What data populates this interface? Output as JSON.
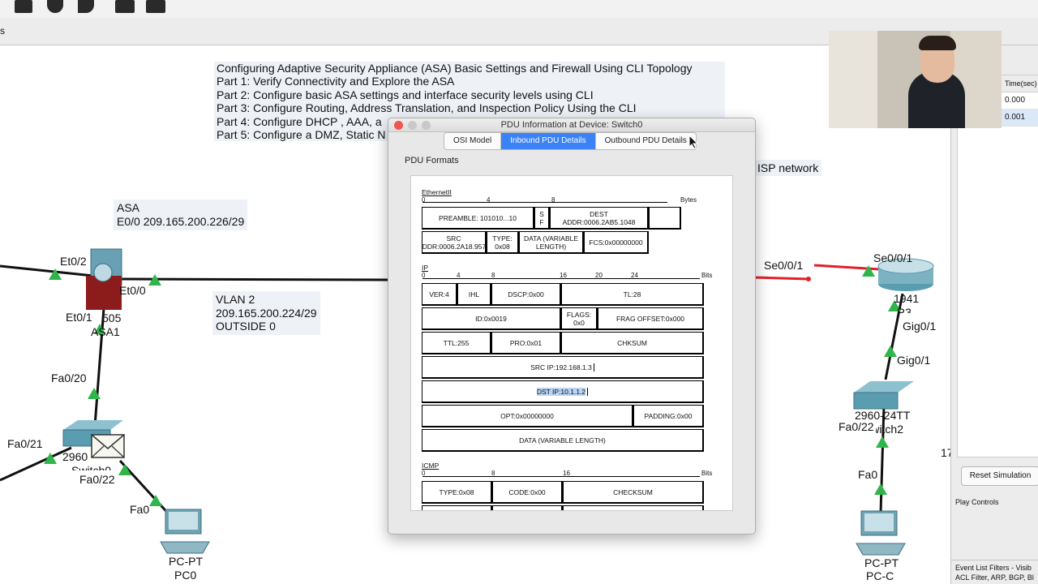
{
  "notes": {
    "lines": [
      "Configuring Adaptive Security Appliance (ASA) Basic Settings and Firewall Using CLI Topology",
      "Part 1: Verify Connectivity and Explore the ASA",
      "Part 2: Configure basic ASA settings and interface security levels using CLI",
      "Part 3: Configure Routing, Address Translation, and Inspection Policy Using the CLI",
      "Part 4: Configure DHCP , AAA, a",
      "Part 5: Configure a DMZ, Static N"
    ]
  },
  "subbar": {
    "left_text": "s"
  },
  "topology": {
    "asa_label_name": "ASA",
    "asa_label_ip": "E0/0 209.165.200.226/29",
    "vlan_title": "VLAN 2",
    "vlan_network": "209.165.200.224/29",
    "vlan_name": "OUTSIDE 0",
    "isp_label": "ISP network",
    "ports": {
      "et0_2": "Et0/2",
      "et0_0": "Et0/0",
      "et0_1": "Et0/1",
      "asa_model": "505",
      "asa_name": "ASA1",
      "fa0_20": "Fa0/20",
      "fa0_21": "Fa0/21",
      "sw_model": "2960",
      "sw_name": "Switch0",
      "fa0_22_left": "Fa0/22",
      "fa0_left": "Fa0",
      "pc0_type": "PC-PT",
      "pc0_name": "PC0",
      "se001_left": "Se0/0/1",
      "se001_right": "Se0/0/1",
      "r3_model": "1941",
      "r3_name": "R3",
      "gig01_a": "Gig0/1",
      "gig01_b": "Gig0/1",
      "sw2_model": "2960-24TT",
      "sw2_name": "Switch2",
      "fa0_22_right": "Fa0/22",
      "fa0_right": "Fa0",
      "pcc_type": "PC-PT",
      "pcc_name": "PC-C",
      "partial_17": "17"
    }
  },
  "right_panel": {
    "time_header": "Time(sec)",
    "rows": [
      "0.000",
      "0.001"
    ],
    "reset_button": "Reset Simulation",
    "play_controls": "Play Controls",
    "event_filters": "Event List Filters - Visib",
    "filter_list": "ACL Filter, ARP, BGP, Bl"
  },
  "dialog": {
    "title": "PDU Information at Device: Switch0",
    "tabs": [
      "OSI Model",
      "Inbound PDU Details",
      "Outbound PDU Details"
    ],
    "active_tab": 1,
    "section_heading": "PDU Formats",
    "ethernet": {
      "name": "EthernetII",
      "ruler": [
        "0",
        "4",
        "8",
        "Bytes"
      ],
      "preamble": "PREAMBLE: 101010...10",
      "sf": "S F",
      "dest": "DEST ADDR:0006.2AB5.1048",
      "src": "SRC ADDR:0006.2A18.9577",
      "type": "TYPE: 0x08",
      "data": "DATA (VARIABLE LENGTH)",
      "fcs": "FCS:0x00000000"
    },
    "ip": {
      "name": "IP",
      "ruler": [
        "0",
        "4",
        "8",
        "16",
        "20",
        "24",
        "Bits"
      ],
      "ver": "VER:4",
      "ihl": "IHL",
      "dscp": "DSCP:0x00",
      "tl": "TL:28",
      "id": "ID:0x0019",
      "flags": "FLAGS: 0x0",
      "frag": "FRAG OFFSET:0x000",
      "ttl": "TTL:255",
      "pro": "PRO:0x01",
      "chksum": "CHKSUM",
      "src_ip": "SRC IP:192.168.1.3",
      "dst_ip": "DST IP:10.1.1.2",
      "opt": "OPT:0x00000000",
      "padding": "PADDING:0x00",
      "data": "DATA (VARIABLE LENGTH)"
    },
    "icmp": {
      "name": "ICMP",
      "ruler": [
        "0",
        "8",
        "16",
        "Bits"
      ],
      "type": "TYPE:0x08",
      "code": "CODE:0x00",
      "checksum": "CHECKSUM"
    }
  },
  "colors": {
    "link_black": "#111111",
    "link_red": "#e0202a",
    "port_green": "#2fb54a",
    "tab_active": "#3b82f6",
    "note_bg": "#eef2f7"
  }
}
